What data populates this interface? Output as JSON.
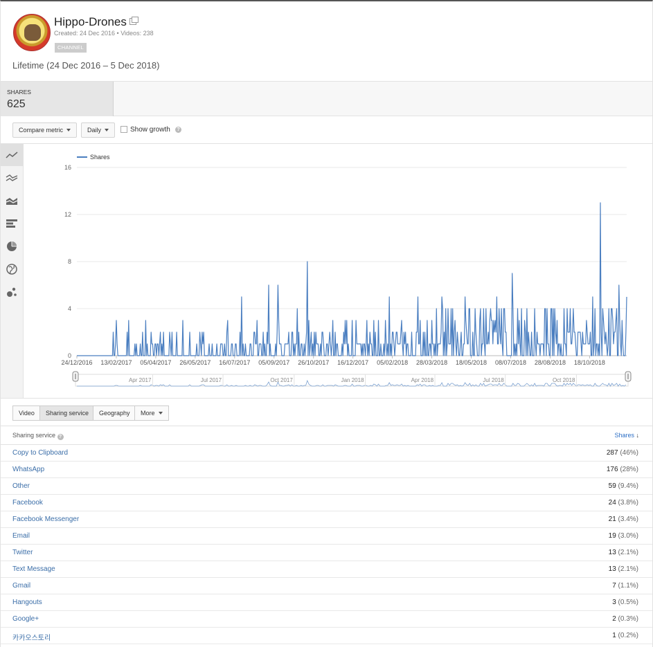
{
  "channel": {
    "name": "Hippo-Drones",
    "meta": "Created: 24 Dec 2016 • Videos: 238",
    "badge": "CHANNEL"
  },
  "date_range": "Lifetime (24 Dec 2016 – 5 Dec 2018)",
  "metric": {
    "label": "SHARES",
    "value": "625"
  },
  "controls": {
    "compare_metric": "Compare metric",
    "granularity": "Daily",
    "show_growth": "Show growth"
  },
  "chart_view_icons": [
    "line-chart-icon",
    "multi-line-chart-icon",
    "stacked-area-icon",
    "bar-chart-icon",
    "pie-chart-icon",
    "map-icon",
    "bubble-chart-icon"
  ],
  "chart_data": {
    "type": "line",
    "legend": [
      "Shares"
    ],
    "ylim": [
      0,
      16
    ],
    "y_ticks": [
      "0",
      "4",
      "8",
      "12",
      "16"
    ],
    "x_ticks": [
      "24/12/2016",
      "13/02/2017",
      "05/04/2017",
      "26/05/2017",
      "16/07/2017",
      "05/09/2017",
      "26/10/2017",
      "16/12/2017",
      "05/02/2018",
      "28/03/2018",
      "18/05/2018",
      "08/07/2018",
      "28/08/2018",
      "18/10/2018"
    ],
    "navigator_ticks": [
      "Apr 2017",
      "Jul 2017",
      "Oct 2017",
      "Jan 2018",
      "Apr 2018",
      "Jul 2018",
      "Oct 2018"
    ],
    "series": [
      {
        "name": "Shares",
        "peaks": [
          {
            "date": "2017-02-13",
            "value": 3
          },
          {
            "date": "2017-03-01",
            "value": 3
          },
          {
            "date": "2017-05-10",
            "value": 3
          },
          {
            "date": "2017-07-25",
            "value": 5
          },
          {
            "date": "2017-08-29",
            "value": 6
          },
          {
            "date": "2017-09-10",
            "value": 6
          },
          {
            "date": "2017-10-05",
            "value": 4
          },
          {
            "date": "2017-10-18",
            "value": 8
          },
          {
            "date": "2018-02-01",
            "value": 5
          },
          {
            "date": "2018-03-10",
            "value": 5
          },
          {
            "date": "2018-04-10",
            "value": 5
          },
          {
            "date": "2018-05-10",
            "value": 5
          },
          {
            "date": "2018-06-20",
            "value": 5
          },
          {
            "date": "2018-07-10",
            "value": 7
          },
          {
            "date": "2018-09-15",
            "value": 4
          },
          {
            "date": "2018-10-22",
            "value": 5
          },
          {
            "date": "2018-11-01",
            "value": 13
          },
          {
            "date": "2018-11-25",
            "value": 6
          },
          {
            "date": "2018-12-05",
            "value": 5
          }
        ]
      }
    ]
  },
  "tabs": [
    "Video",
    "Sharing service",
    "Geography",
    "More"
  ],
  "table": {
    "col_left": "Sharing service",
    "col_right": "Shares",
    "rows": [
      {
        "name": "Copy to Clipboard",
        "value": "287",
        "pct": "(46%)"
      },
      {
        "name": "WhatsApp",
        "value": "176",
        "pct": "(28%)"
      },
      {
        "name": "Other",
        "value": "59",
        "pct": "(9.4%)"
      },
      {
        "name": "Facebook",
        "value": "24",
        "pct": "(3.8%)"
      },
      {
        "name": "Facebook Messenger",
        "value": "21",
        "pct": "(3.4%)"
      },
      {
        "name": "Email",
        "value": "19",
        "pct": "(3.0%)"
      },
      {
        "name": "Twitter",
        "value": "13",
        "pct": "(2.1%)"
      },
      {
        "name": "Text Message",
        "value": "13",
        "pct": "(2.1%)"
      },
      {
        "name": "Gmail",
        "value": "7",
        "pct": "(1.1%)"
      },
      {
        "name": "Hangouts",
        "value": "3",
        "pct": "(0.5%)"
      },
      {
        "name": "Google+",
        "value": "2",
        "pct": "(0.3%)"
      },
      {
        "name": "카카오스토리",
        "value": "1",
        "pct": "(0.2%)"
      }
    ]
  },
  "colors": {
    "line": "#4a7ec0",
    "link": "#3b6ea8",
    "accent": "#2c6ec5"
  }
}
